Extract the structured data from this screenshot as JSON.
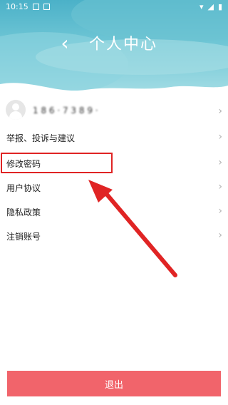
{
  "status_bar": {
    "time": "10:15"
  },
  "header": {
    "back_icon": "chevron-left-icon",
    "title": "个人中心"
  },
  "user": {
    "phone": "1 8 6 · 7 3 8 9 ·",
    "chevron": "›"
  },
  "menu": [
    {
      "label": "举报、投诉与建议",
      "chevron": "›"
    },
    {
      "label": "修改密码",
      "chevron": "›"
    },
    {
      "label": "用户协议",
      "chevron": "›"
    },
    {
      "label": "隐私政策",
      "chevron": "›"
    },
    {
      "label": "注销账号",
      "chevron": "›"
    }
  ],
  "logout_label": "退出",
  "colors": {
    "header_top": "#4bb1c8",
    "header_bottom": "#a9dfe6",
    "highlight": "#e02424",
    "logout_bg": "#f1646b"
  }
}
